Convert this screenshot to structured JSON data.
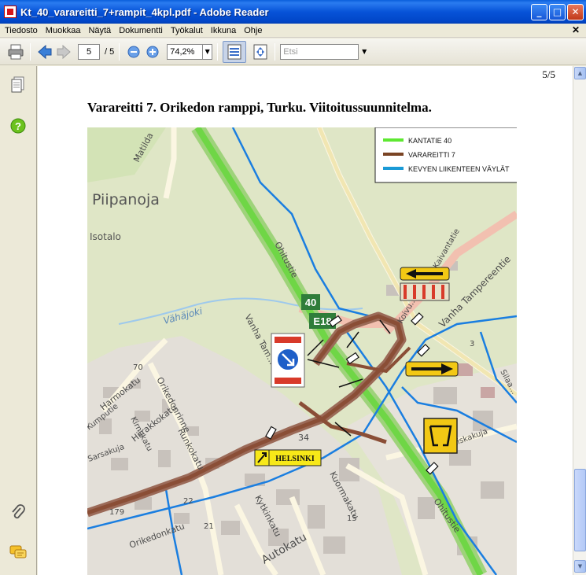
{
  "window": {
    "title": "Kt_40_varareitti_7+rampit_4kpl.pdf - Adobe Reader",
    "buttons": {
      "minimize": "_",
      "maximize": "□",
      "close": "✕"
    }
  },
  "menu": {
    "items": [
      "Tiedosto",
      "Muokkaa",
      "Näytä",
      "Dokumentti",
      "Työkalut",
      "Ikkuna",
      "Ohje"
    ],
    "close": "✕"
  },
  "toolbar": {
    "page_current": "5",
    "page_total": "/ 5",
    "zoom": "74,2%",
    "search_placeholder": "Etsi"
  },
  "document": {
    "page_number": "5/5",
    "title": "Varareitti 7. Orikedon ramppi, Turku. Viitoitussuunnitelma."
  },
  "legend": [
    {
      "label": "KANTATIE 40",
      "color": "#5ee832"
    },
    {
      "label": "VARAREITTI 7",
      "color": "#7a4424"
    },
    {
      "label": "KEVYEN LIIKENTEEN VÄYLÄT",
      "color": "#1a9ad6"
    }
  ],
  "map_labels": {
    "area": "Piipanoja",
    "isotalo": "Isotalo",
    "creek": "Vähäjoki",
    "ohitustie_north": "Ohitustie",
    "ohitustie_south": "Ohitustie",
    "matilda": "Matilda",
    "vanha_tampereentie": "Vanha Tampereentie",
    "vanha_tampereentie_west": "Vanha Tam...",
    "kaivanta": "Kaivantatie",
    "koivuk": "Koivu...",
    "harmokatu": "Harmokatu",
    "orikedonrinne": "Orikedonrinne",
    "hiirakkokatu": "Hiirakkokatu",
    "runkokatu": "Runkokatu",
    "kirnukatu": "Kirnukatu",
    "kumputie": "Kumputie",
    "sarsakuja": "Sarsakuja",
    "kuormakatu": "Kuormakatu",
    "kytkinkatu": "Kytkinkatu",
    "autokatu": "Autokatu",
    "orikedonkatu": "Orikedonkatu",
    "riskakuja": "Riskakuja",
    "silaakatu": "Silaa...",
    "helsinki_sign": "HELSINKI",
    "road_40": "40",
    "road_e18": "E18",
    "num_70": "70",
    "num_34": "34",
    "num_22": "22",
    "num_21": "21",
    "num_179": "179",
    "num_15": "15",
    "num_3": "3"
  }
}
